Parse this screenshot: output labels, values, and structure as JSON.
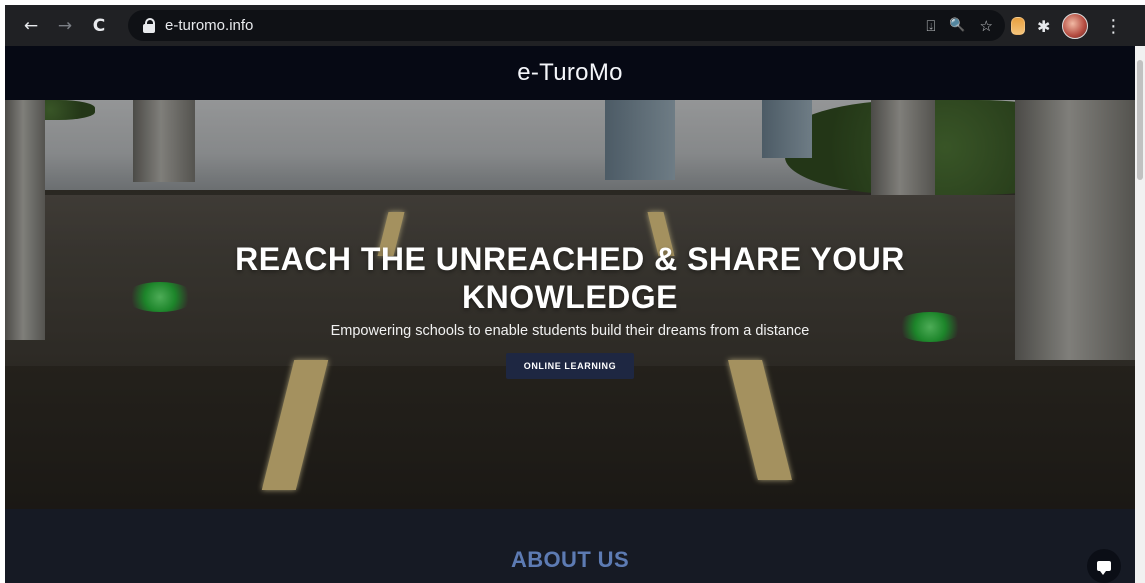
{
  "browser": {
    "back_icon": "←",
    "forward_icon": "→",
    "reload_icon": "C",
    "url": "e-turomo.info",
    "install_icon": "⍗",
    "zoom_icon": "🔍",
    "bookmark_icon": "☆",
    "extensions_icon": "✱",
    "menu_icon": "⋮"
  },
  "site": {
    "brand": "e-TuroMo"
  },
  "hero": {
    "title": "REACH THE UNREACHED & SHARE YOUR KNOWLEDGE",
    "subtitle": "Empowering schools to enable students build their dreams from a distance",
    "cta_label": "ONLINE LEARNING"
  },
  "about": {
    "title": "ABOUT US"
  },
  "colors": {
    "header_bg": "#060914",
    "button_bg": "#1e2742",
    "about_title": "#5d7bb3",
    "page_bg": "#161a24"
  }
}
